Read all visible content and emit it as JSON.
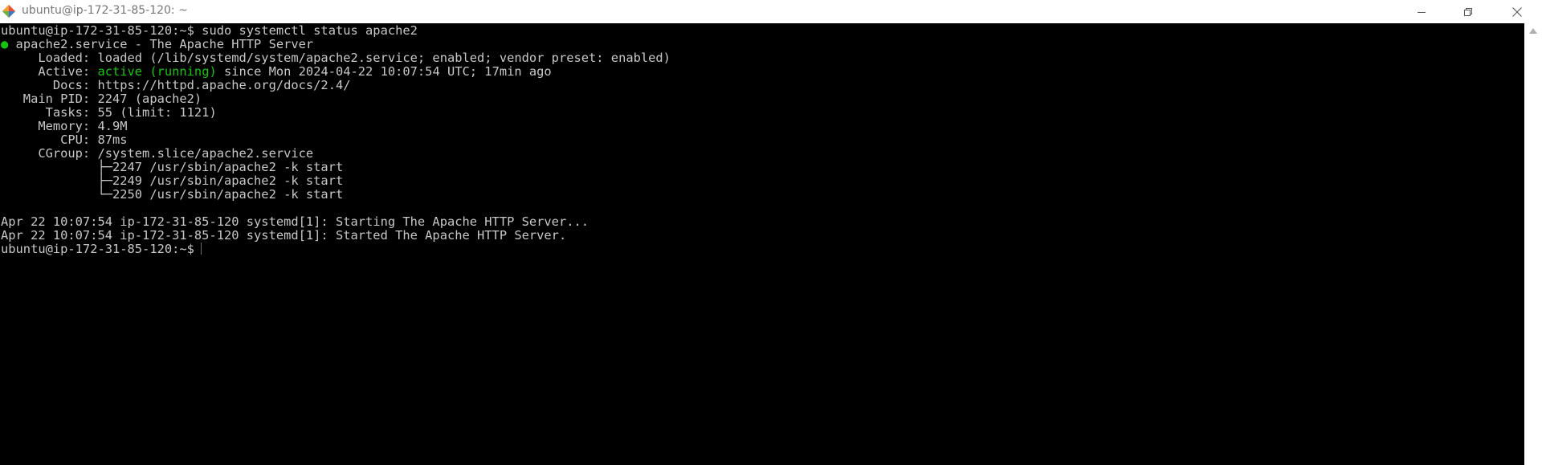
{
  "window": {
    "title": "ubuntu@ip-172-31-85-120: ~",
    "icon": "git-bash-icon"
  },
  "terminal": {
    "lines": [
      {
        "text": "ubuntu@ip-172-31-85-120:~$ sudo systemctl status apache2"
      },
      {
        "bullet": "●",
        "text": " apache2.service - The Apache HTTP Server"
      },
      {
        "text": "     Loaded: loaded (/lib/systemd/system/apache2.service; enabled; vendor preset: enabled)"
      },
      {
        "pre": "     Active: ",
        "status": "active (running)",
        "post": " since Mon 2024-04-22 10:07:54 UTC; 17min ago"
      },
      {
        "text": "       Docs: https://httpd.apache.org/docs/2.4/"
      },
      {
        "text": "   Main PID: 2247 (apache2)"
      },
      {
        "text": "      Tasks: 55 (limit: 1121)"
      },
      {
        "text": "     Memory: 4.9M"
      },
      {
        "text": "        CPU: 87ms"
      },
      {
        "text": "     CGroup: /system.slice/apache2.service"
      },
      {
        "text": "             ├─2247 /usr/sbin/apache2 -k start"
      },
      {
        "text": "             ├─2249 /usr/sbin/apache2 -k start"
      },
      {
        "text": "             └─2250 /usr/sbin/apache2 -k start"
      },
      {
        "text": ""
      },
      {
        "text": "Apr 22 10:07:54 ip-172-31-85-120 systemd[1]: Starting The Apache HTTP Server..."
      },
      {
        "text": "Apr 22 10:07:54 ip-172-31-85-120 systemd[1]: Started The Apache HTTP Server."
      },
      {
        "text": "ubuntu@ip-172-31-85-120:~$"
      }
    ]
  },
  "colors": {
    "background": "#000000",
    "foreground": "#c8c8c8",
    "active_green": "#16c60c"
  }
}
